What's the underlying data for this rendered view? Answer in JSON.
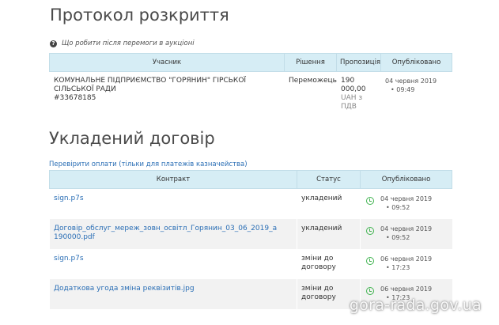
{
  "disclosure": {
    "title": "Протокол розкриття",
    "help_text": "Що робити після перемоги в аукціоні",
    "columns": [
      "Учасник",
      "Рішення",
      "Пропозиція",
      "Опубліковано"
    ],
    "row": {
      "participant_name": "КОМУНАЛЬНЕ ПІДПРИЄМСТВО \"ГОРЯНИН\" ГІРСЬКОЇ СІЛЬСЬКОЇ РАДИ",
      "participant_code": "#33678185",
      "decision": "Переможець",
      "offer_amount": "190 000,00",
      "offer_note": "UAH з ПДВ",
      "published_date": "04 червня 2019",
      "published_time": "09:49"
    }
  },
  "contract": {
    "title": "Укладений договір",
    "check_link": "Перевірити оплати (тільки для платежів казначейства)",
    "columns": [
      "Контракт",
      "Статус",
      "Опубліковано"
    ],
    "rows": [
      {
        "file": "sign.p7s",
        "status": "укладений",
        "date": "04 червня 2019",
        "time": "09:52"
      },
      {
        "file": "Договір_обслуг_мереж_зовн_освітл_Горянин_03_06_2019_а 190000.pdf",
        "status": "укладений",
        "date": "04 червня 2019",
        "time": "09:52"
      },
      {
        "file": "sign.p7s",
        "status": "зміни до договору",
        "date": "06 червня 2019",
        "time": "17:23"
      },
      {
        "file": "Додаткова угода зміна реквізитів.jpg",
        "status": "зміни до договору",
        "date": "06 червня 2019",
        "time": "17:23"
      }
    ]
  },
  "watermark": "gora-rada.gov.ua",
  "colors": {
    "header_bg": "#d6edf5",
    "link": "#2a6eb5",
    "clock": "#3fb34f"
  }
}
